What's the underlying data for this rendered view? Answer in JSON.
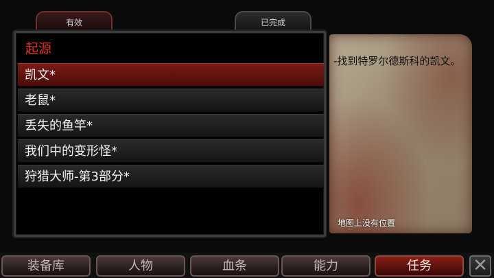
{
  "tabs": {
    "active": "有效",
    "completed": "已完成"
  },
  "quest_list": {
    "section_title": "起源",
    "items": [
      "凯文*",
      "老鼠*",
      "丢失的鱼竿*",
      "我们中的变形怪*",
      "狩猎大师-第3部分*"
    ]
  },
  "detail": {
    "objective": "-找到特罗尔德斯科的凯文。",
    "map_note": "地图上没有位置"
  },
  "nav": {
    "inventory": "装备库",
    "character": "人物",
    "health": "血条",
    "abilities": "能力",
    "quests": "任务"
  },
  "close": "✕",
  "colors": {
    "accent": "#e8352a",
    "selected_row": "#7a1a14"
  }
}
